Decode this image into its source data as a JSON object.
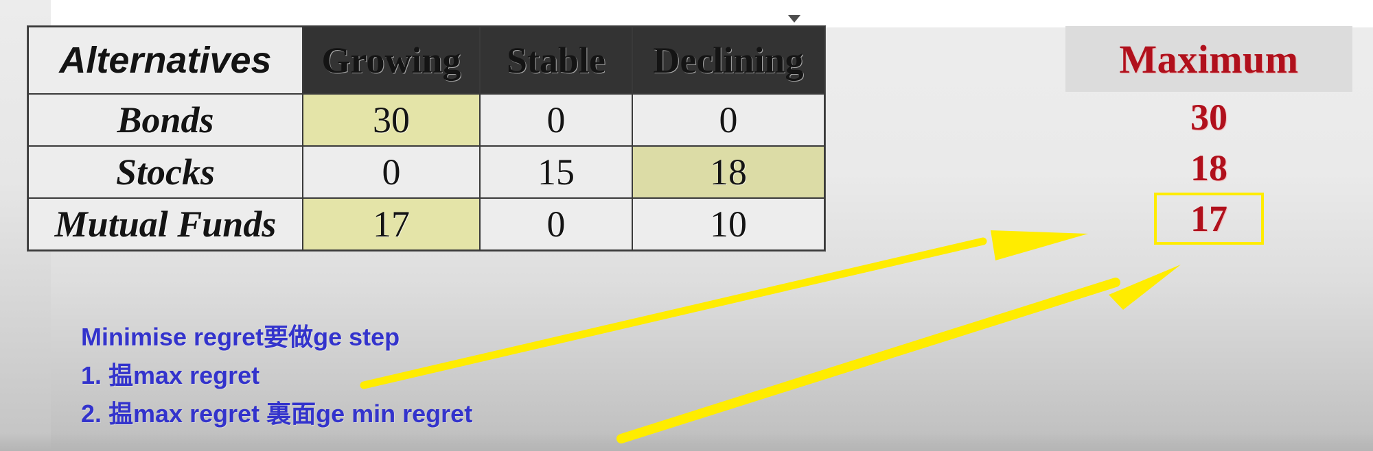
{
  "table": {
    "headers": [
      "Alternatives",
      "Growing",
      "Stable",
      "Declining"
    ],
    "rows": [
      {
        "label": "Bonds",
        "values": [
          "30",
          "0",
          "0"
        ],
        "highlight": [
          true,
          false,
          false
        ]
      },
      {
        "label": "Stocks",
        "values": [
          "0",
          "15",
          "18"
        ],
        "highlight": [
          false,
          false,
          true
        ]
      },
      {
        "label": "Mutual Funds",
        "values": [
          "17",
          "0",
          "10"
        ],
        "highlight": [
          true,
          false,
          false
        ]
      }
    ]
  },
  "maximum": {
    "header": "Maximum",
    "values": [
      "30",
      "18",
      "17"
    ],
    "boxed_index": 2
  },
  "notes": {
    "line1": "Minimise regret要做ge step",
    "line2": "1. 揾max regret",
    "line3": "2. 揾max regret 裏面ge min regret"
  },
  "colors": {
    "header_dark": "#333333",
    "highlight": "#dcdca6",
    "max_red": "#b0101c",
    "note_blue": "#3333cc",
    "arrow_yellow": "#ffec00",
    "box_yellow": "#ffec00"
  }
}
